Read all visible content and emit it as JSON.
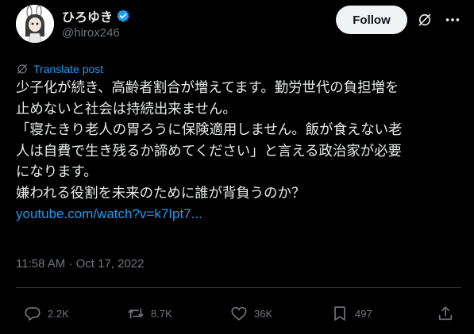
{
  "author": {
    "display_name": "ひろゆき",
    "handle": "@hirox246",
    "verified": true
  },
  "header": {
    "follow_label": "Follow",
    "more_icon": "more-icon"
  },
  "tweet": {
    "translate_label": "Translate post",
    "lines": [
      "少子化が続き、高齢者割合が増えてます。勤労世代の負担増を",
      "止めないと社会は持続出来ません。",
      "「寝たきり老人の胃ろうに保険適用しません。飯が食えない老",
      "人は自費で生き残るか諦めてください」と言える政治家が必要",
      "になります。",
      "嫌われる役割を未来のために誰が背負うのか？"
    ],
    "link_text": "youtube.com/watch?v=k7Ipt7...",
    "timestamp": "11:58 AM · Oct 17, 2022"
  },
  "actions": {
    "replies": "2.2K",
    "reposts": "8.7K",
    "likes": "36K",
    "bookmarks": "497"
  },
  "colors": {
    "background": "#000000",
    "text": "#e7e9ea",
    "muted": "#71767b",
    "link": "#1d9bf0",
    "verified": "#1d9bf0",
    "follow_bg": "#eff3f4"
  }
}
